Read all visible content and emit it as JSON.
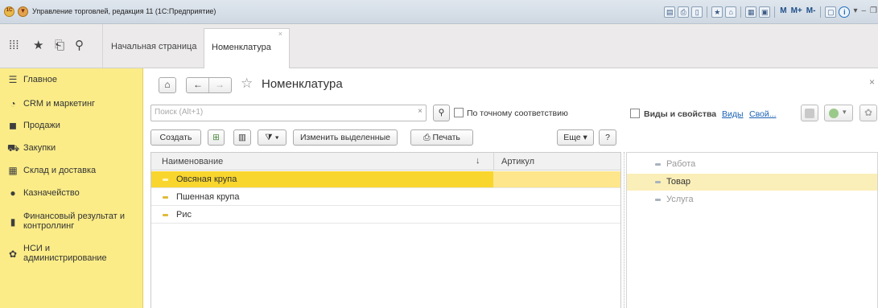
{
  "window": {
    "title": "Управление торговлей, редакция 11 (1С:Предприятие)",
    "toolbar_text_buttons": [
      "M",
      "M+",
      "M-"
    ]
  },
  "tabs": {
    "home_label": "Начальная страница",
    "active_label": "Номенклатура",
    "close_glyph": "×"
  },
  "sidebar": {
    "items": [
      {
        "label": "Главное",
        "icon": "menu-icon"
      },
      {
        "label": "CRM и маркетинг",
        "icon": "crm-icon"
      },
      {
        "label": "Продажи",
        "icon": "bag-icon"
      },
      {
        "label": "Закупки",
        "icon": "cart-icon"
      },
      {
        "label": "Склад и доставка",
        "icon": "warehouse-icon"
      },
      {
        "label": "Казначейство",
        "icon": "money-icon"
      },
      {
        "label": "Финансовый результат и\nконтроллинг",
        "icon": "chart-icon"
      },
      {
        "label": "НСИ и\nадминистрирование",
        "icon": "gear-icon"
      }
    ]
  },
  "form": {
    "title": "Номенклатура",
    "search_placeholder": "Поиск (Alt+1)",
    "exact_match_label": "По точному соответствию",
    "buttons": {
      "create": "Создать",
      "edit_selected": "Изменить выделенные",
      "print": "Печать",
      "more": "Еще",
      "help": "?"
    },
    "columns": [
      "Наименование",
      "Артикул"
    ],
    "sort_glyph": "↓",
    "rows": [
      {
        "name": "Овсяная крупа",
        "article": "",
        "selected": true
      },
      {
        "name": "Пшенная крупа",
        "article": "",
        "selected": false
      },
      {
        "name": "Рис",
        "article": "",
        "selected": false
      }
    ]
  },
  "right_panel": {
    "checkbox_label": "Виды и свойства",
    "link_kinds": "Виды",
    "link_props": "Свой...",
    "items": [
      {
        "label": "Работа",
        "selected": false
      },
      {
        "label": "Товар",
        "selected": true
      },
      {
        "label": "Услуга",
        "selected": false
      }
    ]
  }
}
